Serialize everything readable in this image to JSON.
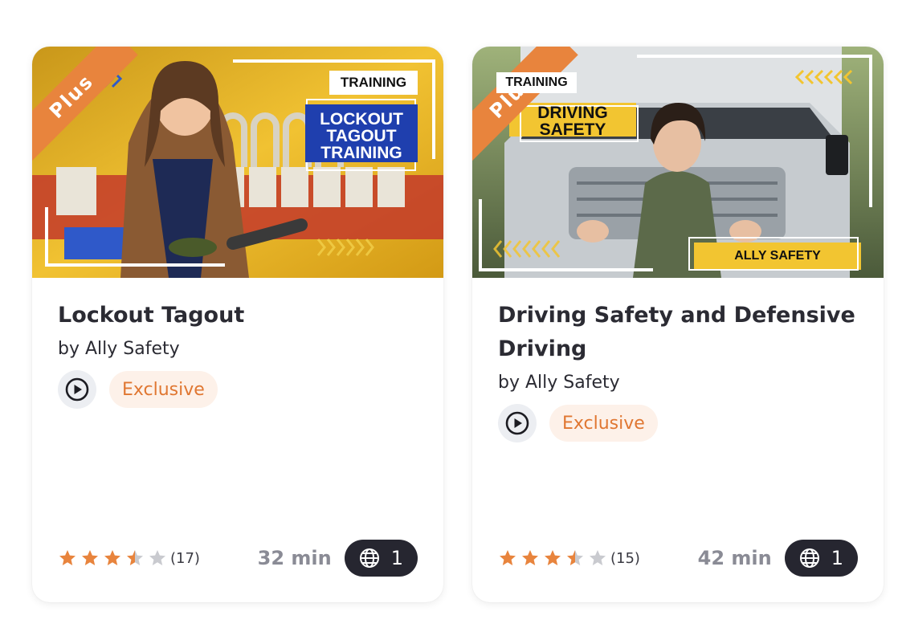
{
  "cards": [
    {
      "ribbon": "Plus",
      "thumb_tag": "TRAINING",
      "thumb_title_lines": [
        "LOCKOUT",
        "TAGOUT",
        "TRAINING"
      ],
      "title": "Lockout Tagout",
      "author": "by Ally Safety",
      "badge": "Exclusive",
      "rating": 3.5,
      "rating_count": "(17)",
      "duration": "32 min",
      "languages": "1"
    },
    {
      "ribbon": "Plus",
      "thumb_tag": "TRAINING",
      "thumb_title_lines": [
        "DRIVING",
        "SAFETY"
      ],
      "thumb_footer": "ALLY SAFETY",
      "title": "Driving Safety and Defensive Driving",
      "author": "by Ally Safety",
      "badge": "Exclusive",
      "rating": 3.5,
      "rating_count": "(15)",
      "duration": "42 min",
      "languages": "1"
    }
  ],
  "colors": {
    "star_filled": "#e8843d",
    "star_empty": "#c9cacf",
    "accent": "#e07732",
    "badge_bg": "#fdf1e9",
    "lang_bg": "#262630"
  },
  "icons": {
    "play": "play-circle-icon",
    "globe": "globe-icon",
    "star": "star-icon"
  }
}
